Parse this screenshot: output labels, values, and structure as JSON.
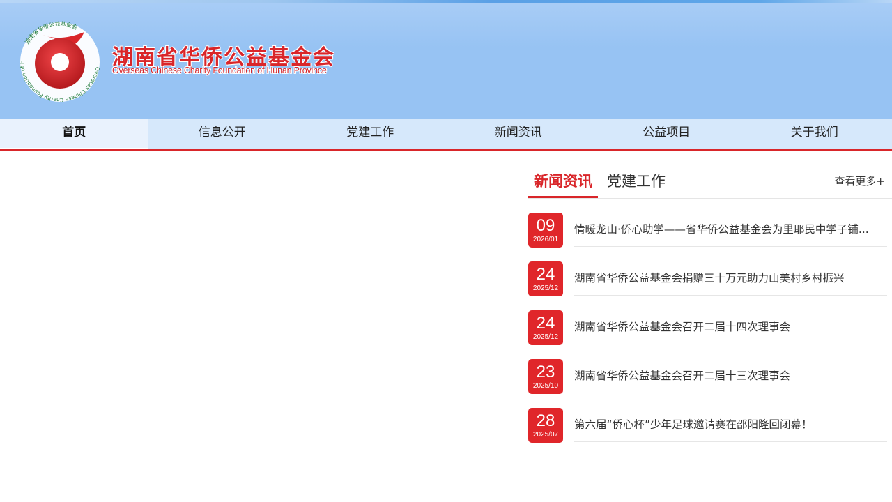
{
  "header": {
    "org_name_cn": "湖南省华侨公益基金会",
    "org_name_en": "Overseas Chinese Charity Foundation of Hunan Province",
    "logo_ring_text_cn": "湖南省华侨公益基金会",
    "logo_ring_text_en": "Overseas Chinese Charity Foundation of Hunan Province"
  },
  "nav": {
    "items": [
      {
        "label": "首页",
        "active": true
      },
      {
        "label": "信息公开",
        "active": false
      },
      {
        "label": "党建工作",
        "active": false
      },
      {
        "label": "新闻资讯",
        "active": false
      },
      {
        "label": "公益项目",
        "active": false
      },
      {
        "label": "关于我们",
        "active": false
      }
    ]
  },
  "news": {
    "tabs": [
      {
        "label": "新闻资讯",
        "active": true
      },
      {
        "label": "党建工作",
        "active": false
      }
    ],
    "more_label": "查看更多+",
    "items": [
      {
        "day": "09",
        "ym": "2026/01",
        "title": "情暖龙山·侨心助学——省华侨公益基金会为里耶民中学子铺..."
      },
      {
        "day": "24",
        "ym": "2025/12",
        "title": "湖南省华侨公益基金会捐赠三十万元助力山美村乡村振兴"
      },
      {
        "day": "24",
        "ym": "2025/12",
        "title": "湖南省华侨公益基金会召开二届十四次理事会"
      },
      {
        "day": "23",
        "ym": "2025/10",
        "title": "湖南省华侨公益基金会召开二届十三次理事会"
      },
      {
        "day": "28",
        "ym": "2025/07",
        "title": "第六届“侨心杯”少年足球邀请赛在邵阳隆回闭幕！"
      }
    ]
  },
  "colors": {
    "brand_red": "#d9262a",
    "header_blue": "#97c3f3",
    "nav_bg": "#d6e8fb"
  }
}
